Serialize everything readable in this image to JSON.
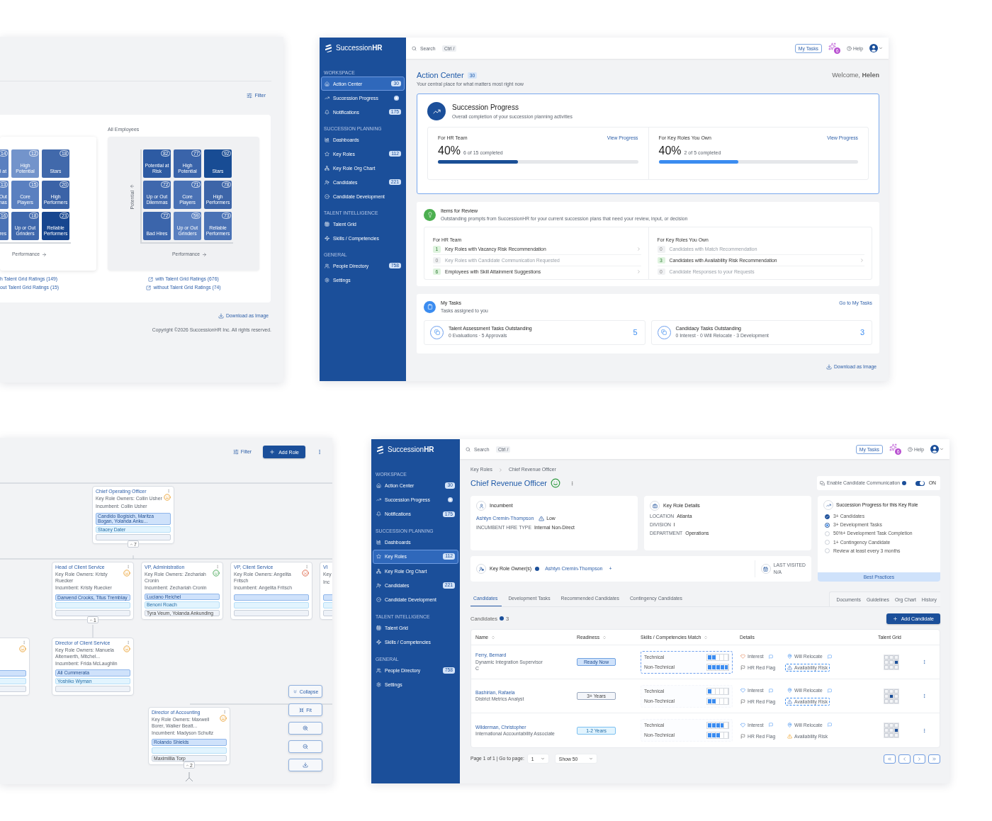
{
  "talent_grid_view": {
    "filter": "Filter",
    "grids": [
      {
        "x_axis": "Performance",
        "cells": [
          {
            "count": "14",
            "label": "l at",
            "color": "#5a80c0"
          },
          {
            "count": "12",
            "label": "High Potential",
            "color": "#7394cb"
          },
          {
            "count": "18",
            "label": "Stars",
            "color": "#4169ab"
          },
          {
            "count": "13",
            "label": "Out nas",
            "color": "#5a80c0"
          },
          {
            "count": "15",
            "label": "Core Players",
            "color": "#5a80c0"
          },
          {
            "count": "20",
            "label": "High Performers",
            "color": "#3b63a7"
          },
          {
            "count": "16",
            "label": "res",
            "color": "#4a72b5"
          },
          {
            "count": "18",
            "label": "Up or Out Grinders",
            "color": "#3f68ad"
          },
          {
            "count": "23",
            "label": "Reliable Performers",
            "color": "#17468f"
          }
        ],
        "links": [
          {
            "text": "h Talent Grid Ratings (149)",
            "icon": false
          },
          {
            "text": "out Talent Grid Ratings (15)",
            "icon": false
          }
        ]
      },
      {
        "title": "All Employees",
        "y_axis": "Potential",
        "x_axis": "Performance",
        "cells": [
          {
            "count": "82",
            "label": "Potential at Risk",
            "color": "#2d5ba3"
          },
          {
            "count": "77",
            "label": "High Potential",
            "color": "#3a64aa"
          },
          {
            "count": "92",
            "label": "Stars",
            "color": "#184c94"
          },
          {
            "count": "72",
            "label": "Up or Out Dilemmas",
            "color": "#3f68ad"
          },
          {
            "count": "71",
            "label": "Core Players",
            "color": "#4a72b5"
          },
          {
            "count": "78",
            "label": "High Performers",
            "color": "#3d65a8"
          },
          {
            "count": "72",
            "label": "Bad Hires",
            "color": "#3b65ab"
          },
          {
            "count": "59",
            "label": "Up or Out Grinders",
            "color": "#5a80c0"
          },
          {
            "count": "73",
            "label": "Reliable Performers",
            "color": "#4a72b5"
          }
        ],
        "links": [
          {
            "text": "with Talent Grid Ratings (676)",
            "icon": true
          },
          {
            "text": "without Talent Grid Ratings (74)",
            "icon": true
          }
        ]
      }
    ],
    "download": "Download as Image",
    "copyright": "Copyright ©2026 SuccessionHR Inc. All rights reserved."
  },
  "action_center_app": {
    "brand": "Succession**HR**",
    "topbar": {
      "search": {
        "placeholder": "Search"
      },
      "shortcut": "Ctrl /",
      "my_tasks": "My Tasks",
      "ai_count": "6",
      "help": "Help"
    },
    "sidebar": [
      {
        "title": "WORKSPACE",
        "items": [
          {
            "label": "Action Center",
            "kind": "count",
            "badge": "30",
            "selected": true
          },
          {
            "label": "Succession Progress",
            "kind": "dot",
            "selected": false
          },
          {
            "label": "Notifications",
            "kind": "count",
            "badge": "175",
            "selected": false
          }
        ]
      },
      {
        "title": "SUCCESSION PLANNING",
        "items": [
          {
            "label": "Dashboards",
            "kind": "plain",
            "selected": false
          },
          {
            "label": "Key Roles",
            "kind": "count",
            "badge": "112",
            "selected": false
          },
          {
            "label": "Key Role Org Chart",
            "kind": "plain",
            "selected": false
          },
          {
            "label": "Candidates",
            "kind": "count",
            "badge": "221",
            "selected": false
          },
          {
            "label": "Candidate Development",
            "kind": "plain",
            "selected": false
          }
        ]
      },
      {
        "title": "TALENT INTELLIGENCE",
        "items": [
          {
            "label": "Talent Grid",
            "kind": "plain",
            "selected": false
          },
          {
            "label": "Skills / Competencies",
            "kind": "plain",
            "selected": false
          }
        ]
      },
      {
        "title": "GENERAL",
        "items": [
          {
            "label": "People Directory",
            "kind": "count",
            "badge": "758",
            "selected": false
          },
          {
            "label": "Settings",
            "kind": "plain",
            "selected": false
          }
        ]
      }
    ],
    "title": "Action Center",
    "count": "30",
    "subtitle": "Your central place for what matters most right now",
    "welcome": "Welcome, **Helen**",
    "progress": {
      "title": "Succession Progress",
      "subtitle": "Overall completion of your succession planning activities",
      "blocks": [
        {
          "title": "For HR Team",
          "link": "View Progress",
          "percent": "40%",
          "detail": "6 of 15 completed",
          "level": 0.4,
          "color": "#1a4f96"
        },
        {
          "title": "For Key Roles You Own",
          "link": "View Progress",
          "percent": "40%",
          "detail": "2 of 5 completed",
          "level": 0.4,
          "color": "#3b8cf0"
        }
      ]
    },
    "review": {
      "title": "Items for Review",
      "subtitle": "Outstanding prompts from SuccessionHR for your current succession plans that need your review, input, or decision",
      "columns": [
        {
          "title": "For HR Team",
          "items": [
            {
              "count": "1",
              "label": "Key Roles with Vacancy Risk Recommendation",
              "disabled": false
            },
            {
              "count": "0",
              "label": "Key Roles with Candidate Communication Requested",
              "disabled": true
            },
            {
              "count": "6",
              "label": "Employees with Skill Attainment Suggestions",
              "disabled": false
            }
          ]
        },
        {
          "title": "For Key Roles You Own",
          "items": [
            {
              "count": "0",
              "label": "Candidates with Match Recommendation",
              "disabled": true
            },
            {
              "count": "3",
              "label": "Candidates with Availability Risk Recommendation",
              "disabled": false
            },
            {
              "count": "0",
              "label": "Candidate Responses to your Requests",
              "disabled": true
            }
          ]
        }
      ]
    },
    "tasks": {
      "title": "My Tasks",
      "subtitle": "Tasks assigned to you",
      "link": "Go to My Tasks",
      "cards": [
        {
          "title": "Talent Assessment Tasks Outstanding",
          "detail": "0 Evaluations · 5 Approvals",
          "count": "5"
        },
        {
          "title": "Candidacy Tasks Outstanding",
          "detail": "0 Interest · 0 Will Relocate · 3 Development",
          "count": "3"
        }
      ]
    },
    "download": "Download as Image"
  },
  "org_chart_view": {
    "filter": "Filter",
    "add": "Add Role",
    "nodes": [
      {
        "title": "Chief Operating Officer",
        "owners": "Key Role Owners: Collin Usher",
        "incumbent": "Incumbent: Collin Usher",
        "mood": {
          "kind": "neutral"
        },
        "expand": "7",
        "slots": [
          {
            "kind": "ready",
            "text": "Candido Bogisich, Maritza Bogan, Yolanda Anku..."
          },
          {
            "kind": "soon",
            "text": "Stacey Dater"
          },
          {
            "kind": "later"
          }
        ]
      },
      {
        "title": "Head of Client Service",
        "owners": "Key Role Owners: Kristy Ruecker",
        "incumbent": "Incumbent: Kristy Ruecker",
        "mood": {
          "kind": "neutral"
        },
        "expand": "1",
        "slots": [
          {
            "kind": "ready",
            "text": "Darwend Crooks, Titus Tremblay"
          },
          {
            "kind": "soon"
          },
          {
            "kind": "later"
          }
        ]
      },
      {
        "title": "VP, Administration",
        "owners": "Key Role Owners: Zechariah Cronin",
        "incumbent": "Incumbent: Zechariah Cronin",
        "mood": {
          "kind": "happy"
        },
        "slots": [
          {
            "kind": "ready",
            "text": "Luciano Reichel"
          },
          {
            "kind": "soon",
            "text": "Benoni Roach"
          },
          {
            "kind": "later",
            "text": "Tyra Veum, Yolanda Ankunding"
          }
        ]
      },
      {
        "title": "VP, Client Service",
        "owners": "Key Role Owners: Angelita Fritsch",
        "incumbent": "Incumbent: Angelita Fritsch",
        "mood": {
          "kind": "sad"
        },
        "slots": [
          {
            "kind": "ready"
          },
          {
            "kind": "soon"
          },
          {
            "kind": "later"
          }
        ]
      },
      {
        "title": "VI",
        "owners": "Key",
        "incumbent": "Inc",
        "slots": [
          {
            "kind": "ready"
          },
          {
            "kind": "soon"
          },
          {
            "kind": "later"
          }
        ]
      },
      {
        "mood": {
          "kind": "neutral"
        },
        "slots": [
          {
            "kind": "ready"
          },
          {
            "kind": "soon"
          },
          {
            "kind": "later"
          }
        ]
      },
      {
        "title": "Director of Client Service",
        "owners": "Key Role Owners: Manuela Altenwerth, Mitchel...",
        "incumbent": "Incumbent: Frida McLaughlin",
        "mood": {
          "kind": "neutral"
        },
        "slots": [
          {
            "kind": "ready",
            "text": "Ali Cummerata"
          },
          {
            "kind": "soon",
            "text": "Yoshiko Wyman"
          },
          {
            "kind": "later"
          }
        ]
      },
      {
        "title": "Director of Accounting",
        "owners": "Key Role Owners: Maxwell Borer, Walker Beatt...",
        "incumbent": "Incumbent: Madyson Schultz",
        "mood": {
          "kind": "neutral"
        },
        "expand": "2",
        "slots": [
          {
            "kind": "ready",
            "text": "Rolando Shields"
          },
          {
            "kind": "soon"
          },
          {
            "kind": "later",
            "text": "Maximillia Torp"
          }
        ]
      }
    ],
    "collapse": "Collapse",
    "fit": "Fit"
  },
  "key_role_app": {
    "brand": "Succession**HR**",
    "topbar": {
      "search": {
        "placeholder": "Search"
      },
      "shortcut": "Ctrl /",
      "my_tasks": "My Tasks",
      "ai_count": "6",
      "help": "Help"
    },
    "sidebar": [
      {
        "title": "WORKSPACE",
        "items": [
          {
            "label": "Action Center",
            "kind": "count",
            "badge": "30",
            "selected": false
          },
          {
            "label": "Succession Progress",
            "kind": "dot",
            "selected": false
          },
          {
            "label": "Notifications",
            "kind": "count",
            "badge": "175",
            "selected": false
          }
        ]
      },
      {
        "title": "SUCCESSION PLANNING",
        "items": [
          {
            "label": "Dashboards",
            "kind": "plain",
            "selected": false
          },
          {
            "label": "Key Roles",
            "kind": "count",
            "badge": "112",
            "selected": true
          },
          {
            "label": "Key Role Org Chart",
            "kind": "plain",
            "selected": false
          },
          {
            "label": "Candidates",
            "kind": "count",
            "badge": "221",
            "selected": false
          },
          {
            "label": "Candidate Development",
            "kind": "plain",
            "selected": false
          }
        ]
      },
      {
        "title": "TALENT INTELLIGENCE",
        "items": [
          {
            "label": "Talent Grid",
            "kind": "plain",
            "selected": false
          },
          {
            "label": "Skills / Competencies",
            "kind": "plain",
            "selected": false
          }
        ]
      },
      {
        "title": "GENERAL",
        "items": [
          {
            "label": "People Directory",
            "kind": "count",
            "badge": "758",
            "selected": false
          },
          {
            "label": "Settings",
            "kind": "plain",
            "selected": false
          }
        ]
      }
    ],
    "breadcrumb": [
      "Key Roles",
      "Chief Revenue Officer"
    ],
    "title": "Chief Revenue Officer",
    "mood": {
      "kind": "happy"
    },
    "communication": {
      "label": "Enable Candidate Communication",
      "on": true,
      "state_text": "ON"
    },
    "incumbent": {
      "heading": "Incumbent",
      "name": "Ashtyn Cremin-Thompson",
      "risk": "Low",
      "field_label": "INCUMBENT HIRE TYPE",
      "field_value": "Internal Non-Direct"
    },
    "details": {
      "heading": "Key Role Details",
      "fields": [
        {
          "label": "LOCATION",
          "value": "Atlanta"
        },
        {
          "label": "DIVISION",
          "value": "I"
        },
        {
          "label": "DEPARTMENT",
          "value": "Operations"
        }
      ]
    },
    "owners": {
      "label": "Key Role Owner(s)",
      "owner": "Ashtyn Cremin-Thompson",
      "add": "+",
      "last_visited_label": "LAST VISITED",
      "last_visited": "N/A"
    },
    "checklist": {
      "title": "Succession Progress for this Key Role",
      "items": [
        {
          "label": "3+ Candidates",
          "kind": "done"
        },
        {
          "label": "3+ Development Tasks",
          "kind": "current"
        },
        {
          "label": "50%+ Development Task Completion",
          "kind": "todo"
        },
        {
          "label": "1+ Contingency Candidate",
          "kind": "todo"
        },
        {
          "label": "Review at least every 3 months",
          "kind": "todo"
        }
      ],
      "footer": "Best Practices"
    },
    "tabs": [
      {
        "label": "Candidates",
        "selected": true
      },
      {
        "label": "Development Tasks",
        "selected": false
      },
      {
        "label": "Recommended Candidates",
        "selected": false
      },
      {
        "label": "Contingency Candidates",
        "selected": false
      }
    ],
    "side_tabs": [
      {
        "label": "Documents",
        "selected": false
      },
      {
        "label": "Guidelines",
        "selected": false
      },
      {
        "label": "Org Chart",
        "selected": false
      },
      {
        "label": "History",
        "selected": false
      }
    ],
    "candidates": {
      "heading": "Candidates",
      "count": "3",
      "add": "Add Candidate",
      "columns": [
        {
          "label": "Name",
          "sortable": true
        },
        {
          "label": "Readiness",
          "sortable": true
        },
        {
          "label": "Skills / Competencies Match",
          "sortable": true
        },
        {
          "label": "Details",
          "sortable": false
        },
        {
          "label": "Talent Grid",
          "sortable": false
        }
      ],
      "rows": [
        {
          "name": "Ferry, Bernard",
          "title": "Dynamic Integration Supervisor",
          "note": "C",
          "readiness": {
            "text": "Ready Now",
            "kind": "ready"
          },
          "skills": [
            {
              "label": "Technical",
              "level": 0.4
            },
            {
              "label": "Non-Technical",
              "level": 1
            }
          ],
          "skills_highlighted": true,
          "interest": "Interest",
          "interest_flag": true,
          "relocate": "Will Relocate",
          "red_flag": "HR Red Flag",
          "availability": "Availability Risk",
          "availability_highlighted": true,
          "availability_warning": false,
          "talent_grid": {
            "kind": "middle-right"
          }
        },
        {
          "name": "Bashirian, Rafaela",
          "title": "District Metrics Analyst",
          "readiness": {
            "text": "3+ Years",
            "kind": "long"
          },
          "skills": [
            {
              "label": "Technical",
              "level": 0.2
            },
            {
              "label": "Non-Technical",
              "level": 0.4
            }
          ],
          "skills_highlighted": false,
          "interest": "Interest",
          "interest_flag": false,
          "relocate": "Will Relocate",
          "red_flag": "HR Red Flag",
          "availability": "Availability Risk",
          "availability_highlighted": true,
          "availability_warning": false,
          "talent_grid": {
            "kind": "middle-center"
          }
        },
        {
          "name": "Wilderman, Christopher",
          "title": "International Accountability Associate",
          "readiness": {
            "text": "1-2 Years",
            "kind": "soon"
          },
          "skills": [
            {
              "label": "Technical",
              "level": 0.8
            },
            {
              "label": "Non-Technical",
              "level": 0.6
            }
          ],
          "skills_highlighted": false,
          "interest": "Interest",
          "interest_flag": false,
          "relocate": "Will Relocate",
          "red_flag": "HR Red Flag",
          "availability": "Availability Risk",
          "availability_highlighted": false,
          "availability_warning": true,
          "talent_grid": {
            "kind": "middle-right"
          }
        }
      ]
    },
    "pagination": {
      "label": "Page 1 of 1 | Go to page:",
      "page": "1",
      "page_size": "Show 50"
    }
  }
}
